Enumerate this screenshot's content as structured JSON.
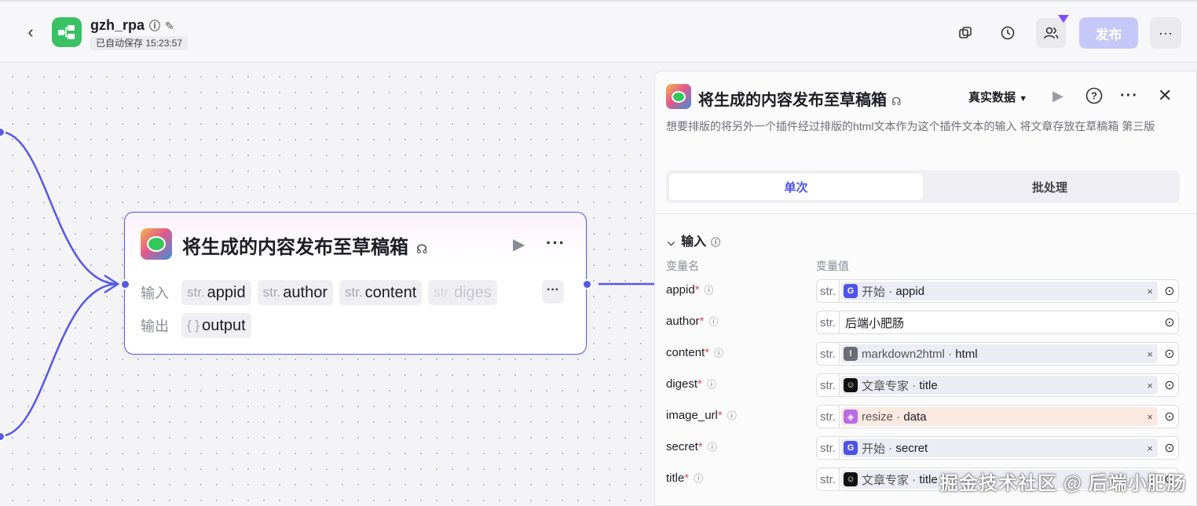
{
  "header": {
    "app_name": "gzh_rpa",
    "save_status": "已自动保存 15:23:57",
    "publish_label": "发布"
  },
  "node": {
    "title": "将生成的内容发布至草稿箱",
    "input_label": "输入",
    "output_label": "输出",
    "inputs": [
      {
        "type": "str.",
        "name": "appid"
      },
      {
        "type": "str.",
        "name": "author"
      },
      {
        "type": "str.",
        "name": "content"
      },
      {
        "type": "str.",
        "name": "diges"
      }
    ],
    "output": {
      "type": "{ }",
      "name": "output"
    }
  },
  "panel": {
    "title": "将生成的内容发布至草稿箱",
    "data_mode": "真实数据",
    "description": "想要排版的将另外一个插件经过排版的html文本作为这个插件文本的输入 将文章存放在草稿箱 第三版",
    "tabs": [
      "单次",
      "批处理"
    ],
    "section_title": "输入",
    "col_name": "变量名",
    "col_value": "变量值",
    "params": [
      {
        "name": "appid",
        "type": "str.",
        "source": "开始",
        "field": "appid",
        "color": "#4d53e8",
        "icon": "start-icon"
      },
      {
        "name": "author",
        "type": "str.",
        "text": "后端小肥肠"
      },
      {
        "name": "content",
        "type": "str.",
        "source": "markdown2html",
        "field": "html",
        "color": "#6b6c76",
        "icon": "exclamation-icon"
      },
      {
        "name": "digest",
        "type": "str.",
        "source": "文章专家",
        "field": "title",
        "color": "#111111",
        "icon": "agent-icon"
      },
      {
        "name": "image_url",
        "type": "str.",
        "source": "resize",
        "field": "data",
        "color": "#b96be6",
        "icon": "cube-icon"
      },
      {
        "name": "secret",
        "type": "str.",
        "source": "开始",
        "field": "secret",
        "color": "#4d53e8",
        "icon": "start-icon"
      },
      {
        "name": "title",
        "type": "str.",
        "source": "文章专家",
        "field": "title",
        "color": "#111111",
        "icon": "agent-icon"
      }
    ]
  },
  "watermark": "掘金技术社区 @ 后端小肥肠"
}
